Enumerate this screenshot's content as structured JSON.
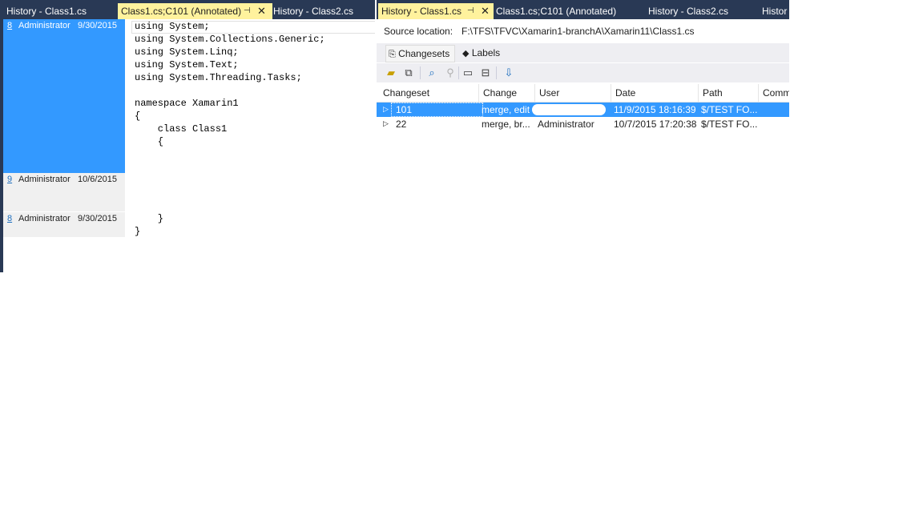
{
  "left": {
    "tabs": [
      {
        "label": "History - Class1.cs",
        "active": false
      },
      {
        "label": "Class1.cs;C101 (Annotated)",
        "active": true
      },
      {
        "label": "History - Class2.cs",
        "active": false
      }
    ],
    "annotations": [
      {
        "changeset": "8",
        "user": "Administrator",
        "date": "9/30/2015",
        "selected": true
      },
      {
        "changeset": "9",
        "user": "Administrator",
        "date": "10/6/2015",
        "selected": false
      },
      {
        "changeset": "8",
        "user": "Administrator",
        "date": "9/30/2015",
        "selected": false
      }
    ],
    "code": {
      "block1": "using System;\nusing System.Collections.Generic;\nusing System.Linq;\nusing System.Text;\nusing System.Threading.Tasks;\n\nnamespace Xamarin1\n{\n    class Class1\n    {",
      "block3": "    }\n}"
    }
  },
  "right": {
    "tabs": [
      {
        "label": "History - Class1.cs",
        "active": true
      },
      {
        "label": "Class1.cs;C101 (Annotated)",
        "active": false
      },
      {
        "label": "History - Class2.cs",
        "active": false
      },
      {
        "label": "Histor",
        "active": false
      }
    ],
    "source_location_label": "Source location:",
    "source_location_value": "F:\\TFS\\TFVC\\Xamarin1-branchA\\Xamarin11\\Class1.cs",
    "subtabs": [
      {
        "label": "Changesets",
        "icon": "changesets-icon",
        "active": true
      },
      {
        "label": "Labels",
        "icon": "label-tag-icon",
        "active": false
      }
    ],
    "toolbar_icons": [
      "open-folder-icon",
      "compare-icon",
      "track-changeset-icon",
      "search-icon",
      "comment-icon",
      "annotate-icon",
      "get-version-icon"
    ],
    "columns": [
      "Changeset",
      "Change",
      "User",
      "Date",
      "Path",
      "Comm"
    ],
    "rows": [
      {
        "changeset": "101",
        "change": "merge, edit",
        "user": "",
        "date": "11/9/2015 18:16:39",
        "path": "$/TEST FO...",
        "selected": true
      },
      {
        "changeset": "22",
        "change": "merge, br...",
        "user": "Administrator",
        "date": "10/7/2015 17:20:38",
        "path": "$/TEST FO...",
        "selected": false
      }
    ]
  },
  "colors": {
    "tab_strip": "#293955",
    "active_tab": "#fff29d",
    "selection": "#3399ff"
  }
}
